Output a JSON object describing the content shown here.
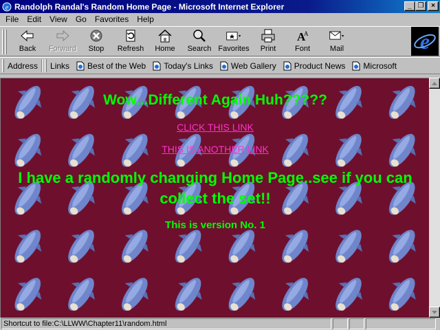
{
  "window": {
    "title": "Randolph Randal's Random Home Page - Microsoft Internet Explorer",
    "minimize": "_",
    "maximize": "❐",
    "close": "×"
  },
  "menu": [
    "File",
    "Edit",
    "View",
    "Go",
    "Favorites",
    "Help"
  ],
  "toolbar": {
    "back": "Back",
    "forward": "Forward",
    "stop": "Stop",
    "refresh": "Refresh",
    "home": "Home",
    "search": "Search",
    "favorites": "Favorites",
    "print": "Print",
    "font": "Font",
    "mail": "Mail"
  },
  "linksbar": {
    "address_label": "Address",
    "links_label": "Links",
    "links": [
      "Best of the Web",
      "Today's Links",
      "Web Gallery",
      "Product News",
      "Microsoft"
    ]
  },
  "page": {
    "heading": "Wow...Different Again Huh?????",
    "link1": "CLICK THIS LINK",
    "link2": "THIS IS ANOTHER LINK",
    "message": "I have a randomly changing Home Page..see if you can collect the set!!",
    "version": "This is version No. 1"
  },
  "status": {
    "text": "Shortcut to file:C:\\LLWW\\Chapter11\\random.html"
  },
  "colors": {
    "page_background": "#6e0f2e",
    "text_green": "#00ff00",
    "link_pink": "#ff33cc",
    "titlebar": "#000080"
  }
}
